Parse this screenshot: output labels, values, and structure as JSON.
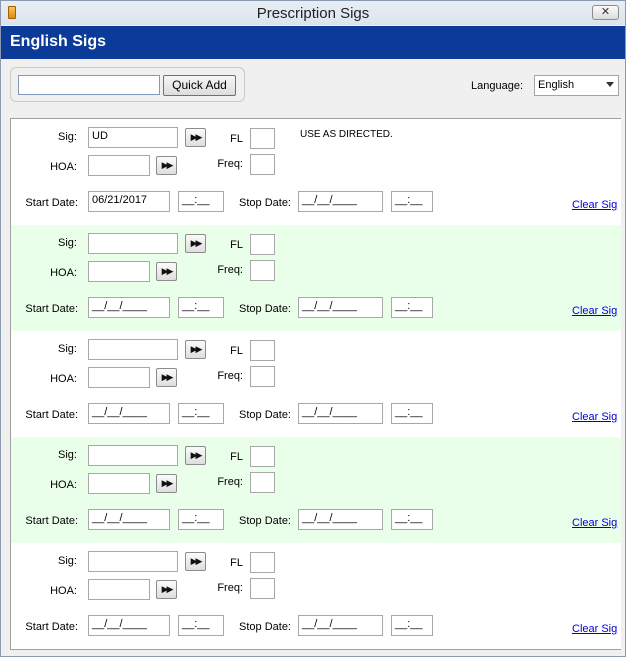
{
  "window": {
    "title": "Prescription Sigs",
    "close_glyph": "✕"
  },
  "header": {
    "title": "English Sigs"
  },
  "quick_add": {
    "input_value": "",
    "button_label": "Quick Add"
  },
  "language": {
    "label": "Language:",
    "selected": "English"
  },
  "labels": {
    "sig": "Sig:",
    "hoa": "HOA:",
    "fl": "FL",
    "freq": "Freq:",
    "start_date": "Start Date:",
    "stop_date": "Stop Date:",
    "clear_sig": "Clear Sig",
    "arrow": "▶▶"
  },
  "sigs": [
    {
      "sig": "UD",
      "hoa": "",
      "fl": "",
      "freq": "",
      "directions": "USE AS DIRECTED.",
      "start_date": "06/21/2017",
      "start_time": "__:__",
      "stop_date": "__/__/____",
      "stop_time": "__:__"
    },
    {
      "sig": "",
      "hoa": "",
      "fl": "",
      "freq": "",
      "directions": "",
      "start_date": "__/__/____",
      "start_time": "__:__",
      "stop_date": "__/__/____",
      "stop_time": "__:__"
    },
    {
      "sig": "",
      "hoa": "",
      "fl": "",
      "freq": "",
      "directions": "",
      "start_date": "__/__/____",
      "start_time": "__:__",
      "stop_date": "__/__/____",
      "stop_time": "__:__"
    },
    {
      "sig": "",
      "hoa": "",
      "fl": "",
      "freq": "",
      "directions": "",
      "start_date": "__/__/____",
      "start_time": "__:__",
      "stop_date": "__/__/____",
      "stop_time": "__:__"
    },
    {
      "sig": "",
      "hoa": "",
      "fl": "",
      "freq": "",
      "directions": "",
      "start_date": "__/__/____",
      "start_time": "__:__",
      "stop_date": "__/__/____",
      "stop_time": "__:__"
    }
  ]
}
